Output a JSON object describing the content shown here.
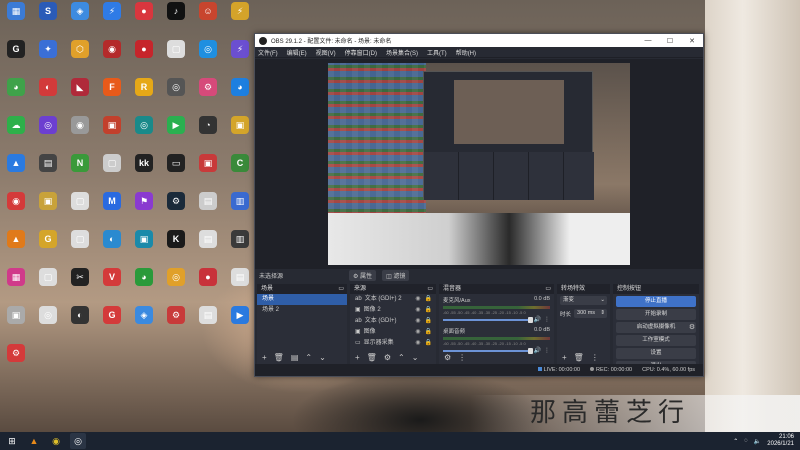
{
  "desktop": {
    "icons": [
      {
        "label": "",
        "glyph": "▦",
        "color": "#3b7bd6"
      },
      {
        "label": "",
        "glyph": "S",
        "color": "#2a5bb8"
      },
      {
        "label": "",
        "glyph": "◈",
        "color": "#3d8be0"
      },
      {
        "label": "",
        "glyph": "⚡",
        "color": "#2f7be6"
      },
      {
        "label": "",
        "glyph": "●",
        "color": "#d9363e"
      },
      {
        "label": "",
        "glyph": "♪",
        "color": "#111"
      },
      {
        "label": "",
        "glyph": "☺",
        "color": "#c8452e"
      },
      {
        "label": "",
        "glyph": "⚡",
        "color": "#d4a32a"
      },
      {
        "label": "",
        "glyph": "G",
        "color": "#222"
      },
      {
        "label": "",
        "glyph": "✦",
        "color": "#3a6fd6"
      },
      {
        "label": "",
        "glyph": "⬡",
        "color": "#e0a02a"
      },
      {
        "label": "",
        "glyph": "◉",
        "color": "#b42a2a"
      },
      {
        "label": "",
        "glyph": "●",
        "color": "#c6252b"
      },
      {
        "label": "",
        "glyph": "▢",
        "color": "#ddd"
      },
      {
        "label": "",
        "glyph": "◎",
        "color": "#1f8fe0"
      },
      {
        "label": "",
        "glyph": "⚡",
        "color": "#6b4fd1"
      },
      {
        "label": "",
        "glyph": "◕",
        "color": "#3fa24a"
      },
      {
        "label": "",
        "glyph": "◐",
        "color": "#d23a3a"
      },
      {
        "label": "",
        "glyph": "◣",
        "color": "#b02a3a"
      },
      {
        "label": "",
        "glyph": "F",
        "color": "#e85a1a"
      },
      {
        "label": "",
        "glyph": "R",
        "color": "#e6a817"
      },
      {
        "label": "",
        "glyph": "◎",
        "color": "#555"
      },
      {
        "label": "",
        "glyph": "⚙",
        "color": "#d64a7a"
      },
      {
        "label": "",
        "glyph": "◕",
        "color": "#1d7fe0"
      },
      {
        "label": "",
        "glyph": "☁",
        "color": "#2eb04a"
      },
      {
        "label": "",
        "glyph": "◎",
        "color": "#6c3fd0"
      },
      {
        "label": "",
        "glyph": "◉",
        "color": "#999"
      },
      {
        "label": "",
        "glyph": "▣",
        "color": "#c2402c"
      },
      {
        "label": "",
        "glyph": "◎",
        "color": "#1a8a8a"
      },
      {
        "label": "",
        "glyph": "▶",
        "color": "#2ab050"
      },
      {
        "label": "",
        "glyph": "◔",
        "color": "#333"
      },
      {
        "label": "",
        "glyph": "▣",
        "color": "#d4a52a"
      },
      {
        "label": "",
        "glyph": "▲",
        "color": "#2a7ae0"
      },
      {
        "label": "",
        "glyph": "▤",
        "color": "#444"
      },
      {
        "label": "",
        "glyph": "N",
        "color": "#3a9a3a"
      },
      {
        "label": "",
        "glyph": "▢",
        "color": "#ccc"
      },
      {
        "label": "",
        "glyph": "kk",
        "color": "#222"
      },
      {
        "label": "",
        "glyph": "▭",
        "color": "#222"
      },
      {
        "label": "",
        "glyph": "▣",
        "color": "#c83a3a"
      },
      {
        "label": "",
        "glyph": "C",
        "color": "#3a8a3a"
      },
      {
        "label": "",
        "glyph": "◉",
        "color": "#d43a3a"
      },
      {
        "label": "",
        "glyph": "▣",
        "color": "#c8a23a"
      },
      {
        "label": "",
        "glyph": "▢",
        "color": "#ddd"
      },
      {
        "label": "",
        "glyph": "M",
        "color": "#2a6ae0"
      },
      {
        "label": "",
        "glyph": "⚑",
        "color": "#8a3ad0"
      },
      {
        "label": "",
        "glyph": "⚙",
        "color": "#1a2a3a"
      },
      {
        "label": "",
        "glyph": "▤",
        "color": "#ccc"
      },
      {
        "label": "",
        "glyph": "▥",
        "color": "#3a6ad0"
      },
      {
        "label": "",
        "glyph": "▲",
        "color": "#e07a1a"
      },
      {
        "label": "",
        "glyph": "G",
        "color": "#d4a52a"
      },
      {
        "label": "",
        "glyph": "▢",
        "color": "#ddd"
      },
      {
        "label": "",
        "glyph": "◐",
        "color": "#2a8ad0"
      },
      {
        "label": "",
        "glyph": "▣",
        "color": "#1a8aaa"
      },
      {
        "label": "",
        "glyph": "K",
        "color": "#1a1a1a"
      },
      {
        "label": "",
        "glyph": "▤",
        "color": "#ddd"
      },
      {
        "label": "",
        "glyph": "▥",
        "color": "#3a3a3a"
      },
      {
        "label": "",
        "glyph": "▦",
        "color": "#d03a8a"
      },
      {
        "label": "",
        "glyph": "▢",
        "color": "#ddd"
      },
      {
        "label": "",
        "glyph": "✂",
        "color": "#222"
      },
      {
        "label": "",
        "glyph": "V",
        "color": "#d43a3a"
      },
      {
        "label": "",
        "glyph": "◕",
        "color": "#2a9a3a"
      },
      {
        "label": "",
        "glyph": "◎",
        "color": "#e0a02a"
      },
      {
        "label": "",
        "glyph": "●",
        "color": "#c8323a"
      },
      {
        "label": "",
        "glyph": "▤",
        "color": "#ddd"
      },
      {
        "label": "",
        "glyph": "▣",
        "color": "#aaa"
      },
      {
        "label": "",
        "glyph": "◎",
        "color": "#ddd"
      },
      {
        "label": "",
        "glyph": "◐",
        "color": "#333"
      },
      {
        "label": "",
        "glyph": "G",
        "color": "#d43a3a"
      },
      {
        "label": "",
        "glyph": "◈",
        "color": "#3a8ae0"
      },
      {
        "label": "",
        "glyph": "⚙",
        "color": "#c83a3a"
      },
      {
        "label": "",
        "glyph": "▤",
        "color": "#ddd"
      },
      {
        "label": "",
        "glyph": "▶",
        "color": "#2a7ae0"
      },
      {
        "label": "",
        "glyph": "⚙",
        "color": "#d43a3a"
      }
    ],
    "banner_text": "那高蕾芝行"
  },
  "obs": {
    "title": "OBS 29.1.2 - 配置文件: 未命名 - 场景: 未命名",
    "menu": [
      "文件(F)",
      "编辑(E)",
      "视图(V)",
      "停靠窗口(D)",
      "场景集合(S)",
      "工具(T)",
      "帮助(H)"
    ],
    "scene_bar": {
      "label": "未选择源",
      "properties": "⚙ 属性",
      "filters": "◫ 滤镜"
    },
    "scenes": {
      "title": "场景",
      "items": [
        "场景",
        "场景 2"
      ]
    },
    "sources": {
      "title": "来源",
      "items": [
        "文本 (GDI+) 2",
        "图像 2",
        "文本 (GDI+)",
        "图像",
        "显示器采集"
      ]
    },
    "mixer": {
      "title": "混音器",
      "channels": [
        {
          "name": "麦克风/Aux",
          "db": "0.0 dB",
          "ticks": "-60 -55 -50 -45 -40 -35 -30 -25 -20 -15 -10 -5 0"
        },
        {
          "name": "桌面音频",
          "db": "0.0 dB",
          "ticks": "-60 -55 -50 -45 -40 -35 -30 -25 -20 -15 -10 -5 0"
        }
      ]
    },
    "transitions": {
      "title": "转场特效",
      "type": "渐变",
      "duration_label": "时长",
      "duration": "300 ms"
    },
    "controls": {
      "title": "控制按钮",
      "buttons": [
        "停止直播",
        "开始录制",
        "启动虚拟摄像机",
        "工作室模式",
        "设置",
        "退出"
      ]
    },
    "status": {
      "live": "LIVE: 00:00:00",
      "rec": "REC: 00:00:00",
      "cpu": "CPU: 0.4%, 60.00 fps"
    }
  },
  "taskbar": {
    "time": "21:06",
    "date": "2026/1/21"
  }
}
